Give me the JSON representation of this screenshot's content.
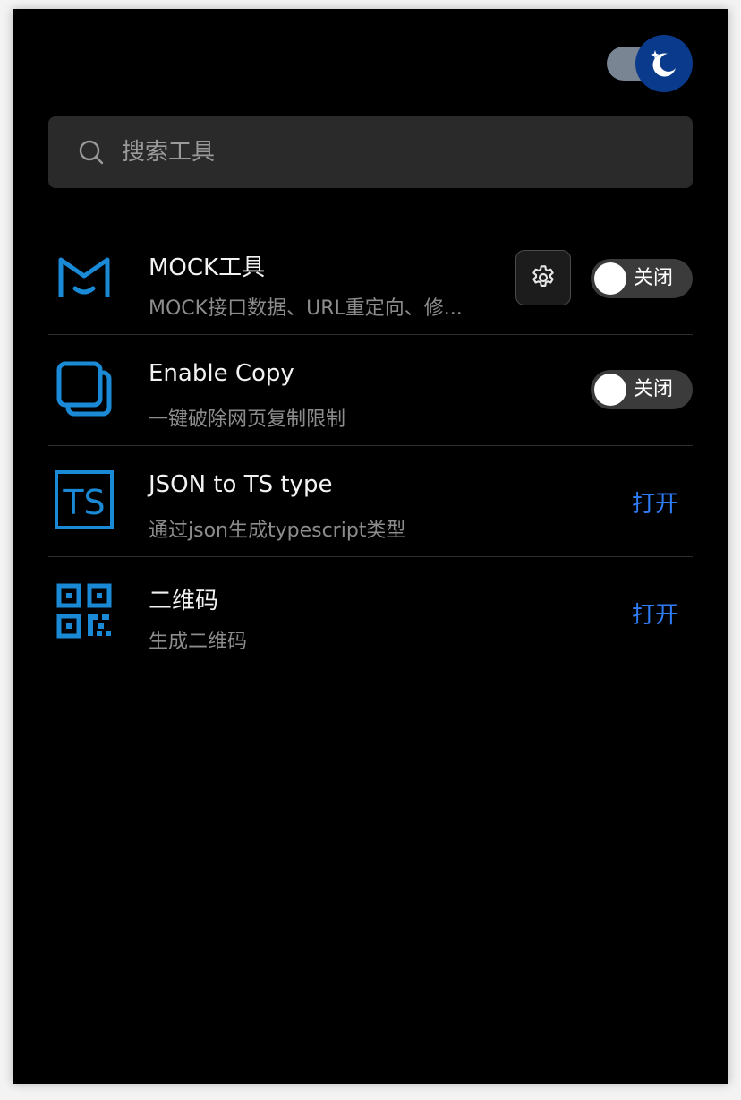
{
  "theme_toggle": {
    "mode": "dark",
    "icon": "moon-icon"
  },
  "search": {
    "placeholder": "搜索工具",
    "value": ""
  },
  "tools": [
    {
      "title": "MOCK工具",
      "description": "MOCK接口数据、URL重定向、修...",
      "icon": "mock-logo-icon",
      "switch_label": "关闭",
      "switch_on": false
    },
    {
      "title": "Enable Copy",
      "description": "一键破除网页复制限制",
      "icon": "copy-icon",
      "switch_label": "关闭",
      "switch_on": false
    },
    {
      "title": "JSON to TS type",
      "description": "通过json生成typescript类型",
      "icon": "ts-icon",
      "icon_text": "TS",
      "action_label": "打开"
    },
    {
      "title": "二维码",
      "description": "生成二维码",
      "icon": "qrcode-icon",
      "action_label": "打开"
    }
  ],
  "colors": {
    "background": "#000000",
    "accent": "#2f7cf6",
    "icon_blue": "#1a8ad6",
    "theme_knob": "#0a3a8c"
  }
}
